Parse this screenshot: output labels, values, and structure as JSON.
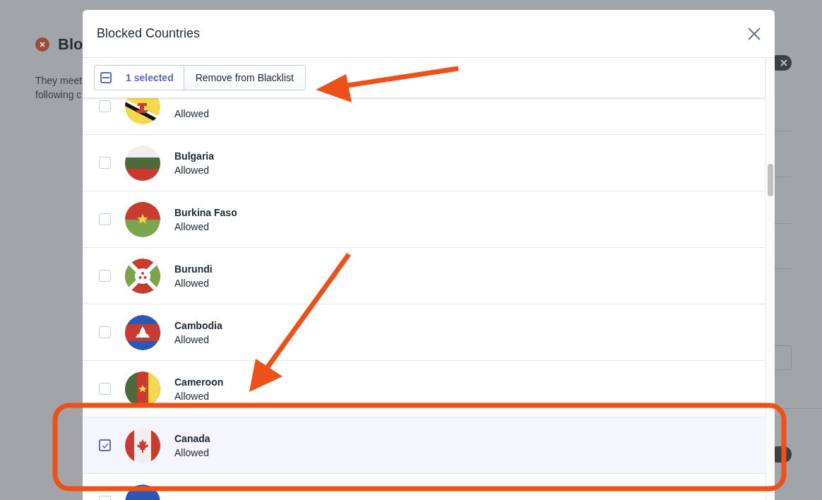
{
  "background_page": {
    "heading": "Blo",
    "description_lines": [
      "They meet",
      "following c"
    ]
  },
  "dialog": {
    "title": "Blocked Countries",
    "bulk_actions": {
      "indeterminate": true,
      "count_label": "1 selected",
      "action": "Remove from Blacklist"
    },
    "countries": [
      {
        "status": "Allowed",
        "selected": false
      },
      {
        "name": "Bulgaria",
        "status": "Allowed",
        "selected": false
      },
      {
        "name": "Burkina Faso",
        "status": "Allowed",
        "selected": false
      },
      {
        "name": "Burundi",
        "status": "Allowed",
        "selected": false
      },
      {
        "name": "Cambodia",
        "status": "Allowed",
        "selected": false
      },
      {
        "name": "Cameroon",
        "status": "Allowed",
        "selected": false
      },
      {
        "name": "Canada",
        "status": "Allowed",
        "selected": true
      },
      {
        "selected": false
      }
    ]
  }
}
